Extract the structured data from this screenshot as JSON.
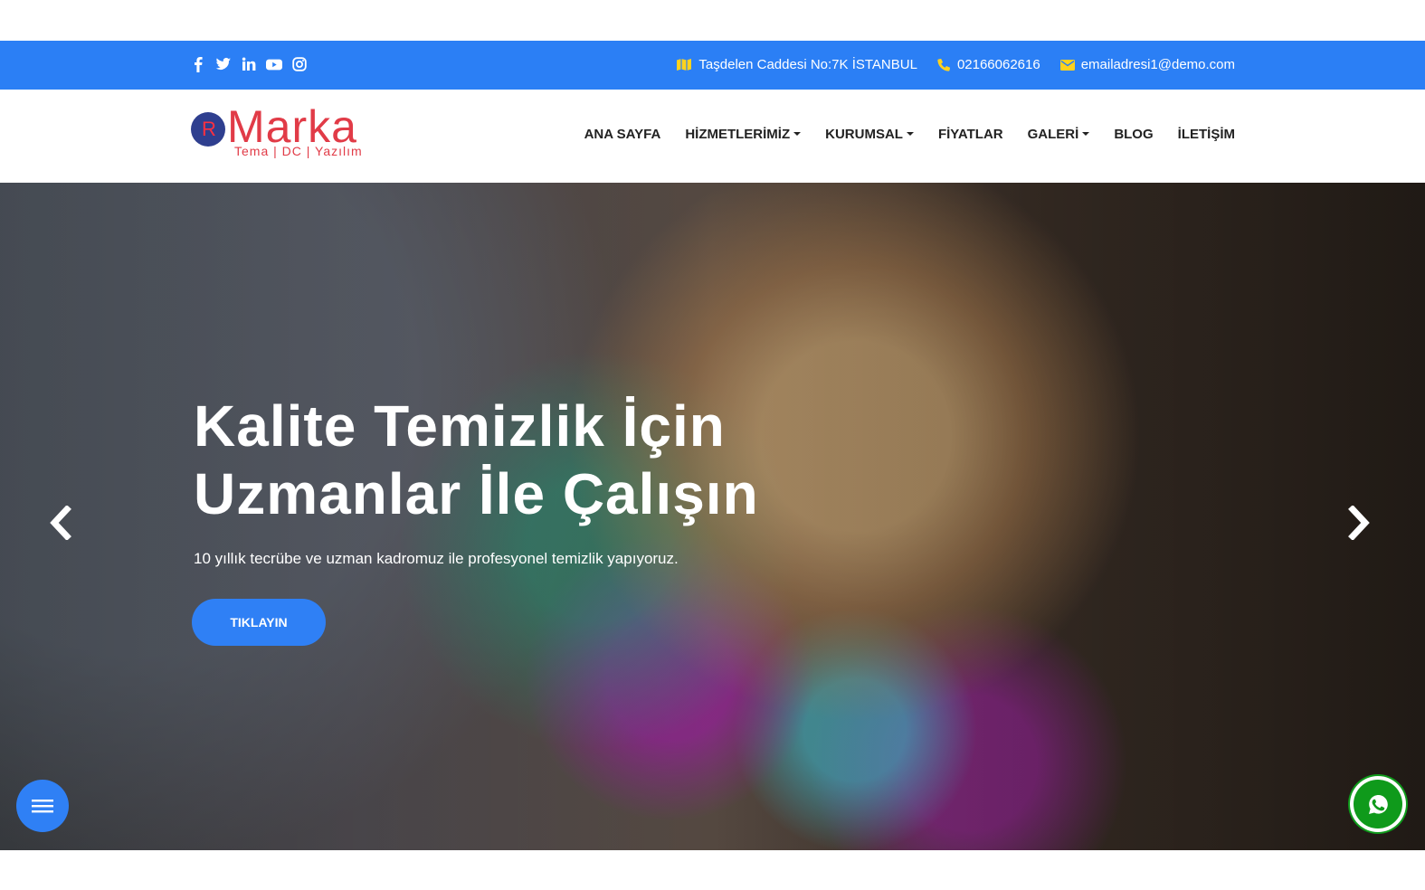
{
  "colors": {
    "primary_blue": "#2b7ff5",
    "brand_red": "#e13b47",
    "icon_yellow": "#ffd21e",
    "whatsapp_green": "#0f9a1b"
  },
  "topbar": {
    "social_icons": [
      "facebook-icon",
      "twitter-icon",
      "linkedin-icon",
      "youtube-icon",
      "instagram-icon"
    ],
    "address": "Taşdelen Caddesi No:7K İSTANBUL",
    "phone": "02166062616",
    "email": "emailadresi1@demo.com"
  },
  "logo": {
    "initial": "R",
    "name": "Marka",
    "tagline": "Tema | DC | Yazılım"
  },
  "nav": {
    "items": [
      {
        "label": "ANA SAYFA"
      },
      {
        "label": "HİZMETLERİMİZ"
      },
      {
        "label": "KURUMSAL"
      },
      {
        "label": "FİYATLAR"
      },
      {
        "label": "GALERİ"
      },
      {
        "label": "BLOG"
      },
      {
        "label": "İLETİŞİM"
      }
    ]
  },
  "hero": {
    "title": "Kalite Temizlik İçin Uzmanlar İle Çalışın",
    "subtitle": "10 yıllık tecrübe ve uzman kadromuz ile profesyonel temizlik yapıyoruz.",
    "button_label": "TIKLAYIN"
  }
}
